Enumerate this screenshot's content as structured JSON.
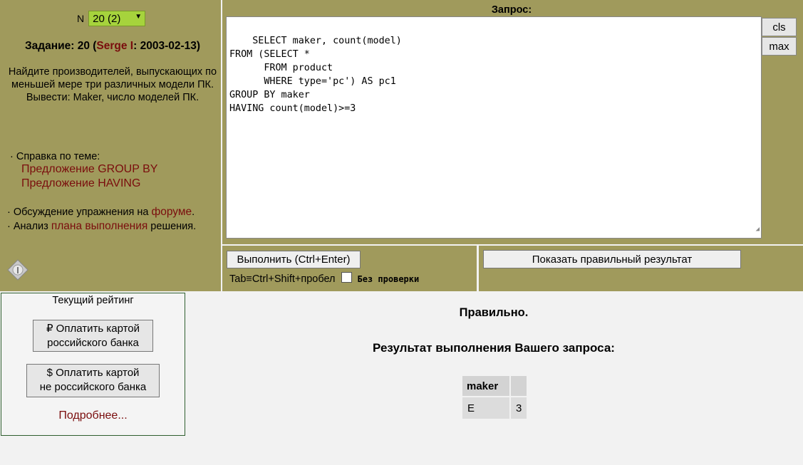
{
  "left": {
    "n_label": "N",
    "n_selected": "20 (2)",
    "task_label": "Задание: 20 (",
    "author": "Serge I",
    "task_date": ": 2003-02-13)",
    "task_text": "Найдите производителей, выпускающих по меньшей мере три различных модели ПК. Вывести: Maker, число моделей ПК.",
    "help_label": "· Справка по теме:",
    "help_links": [
      "Предложение GROUP BY",
      "Предложение HAVING"
    ],
    "forum_prefix": "· Обсуждение упражнения на ",
    "forum_link": "форуме",
    "forum_suffix": ".",
    "plan_prefix": "· Анализ ",
    "plan_link": "плана выполнения",
    "plan_suffix": " решения."
  },
  "query": {
    "title": "Запрос:",
    "sql": "SELECT maker, count(model)\nFROM (SELECT *\n      FROM product\n      WHERE type='pc') AS pc1\nGROUP BY maker\nHAVING count(model)>=3",
    "cls_label": "cls",
    "max_label": "max"
  },
  "exec": {
    "run_label": "Выполнить (Ctrl+Enter)",
    "tab_hint": "Tab≡Ctrl+Shift+пробел",
    "no_check_label": "Без проверки",
    "show_result_label": "Показать правильный результат"
  },
  "rating": {
    "title": "Текущий рейтинг",
    "pay_ru": "₽ Оплатить картой российского банка",
    "pay_ru_line1": "₽ Оплатить картой",
    "pay_ru_line2": "российского банка",
    "pay_foreign_line1": "$ Оплатить картой",
    "pay_foreign_line2": "не российского банка",
    "more": "Подробнее..."
  },
  "result": {
    "status": "Правильно.",
    "title": "Результат выполнения Вашего запроса:",
    "columns": [
      "maker",
      ""
    ],
    "rows": [
      [
        "E",
        "3"
      ]
    ]
  }
}
